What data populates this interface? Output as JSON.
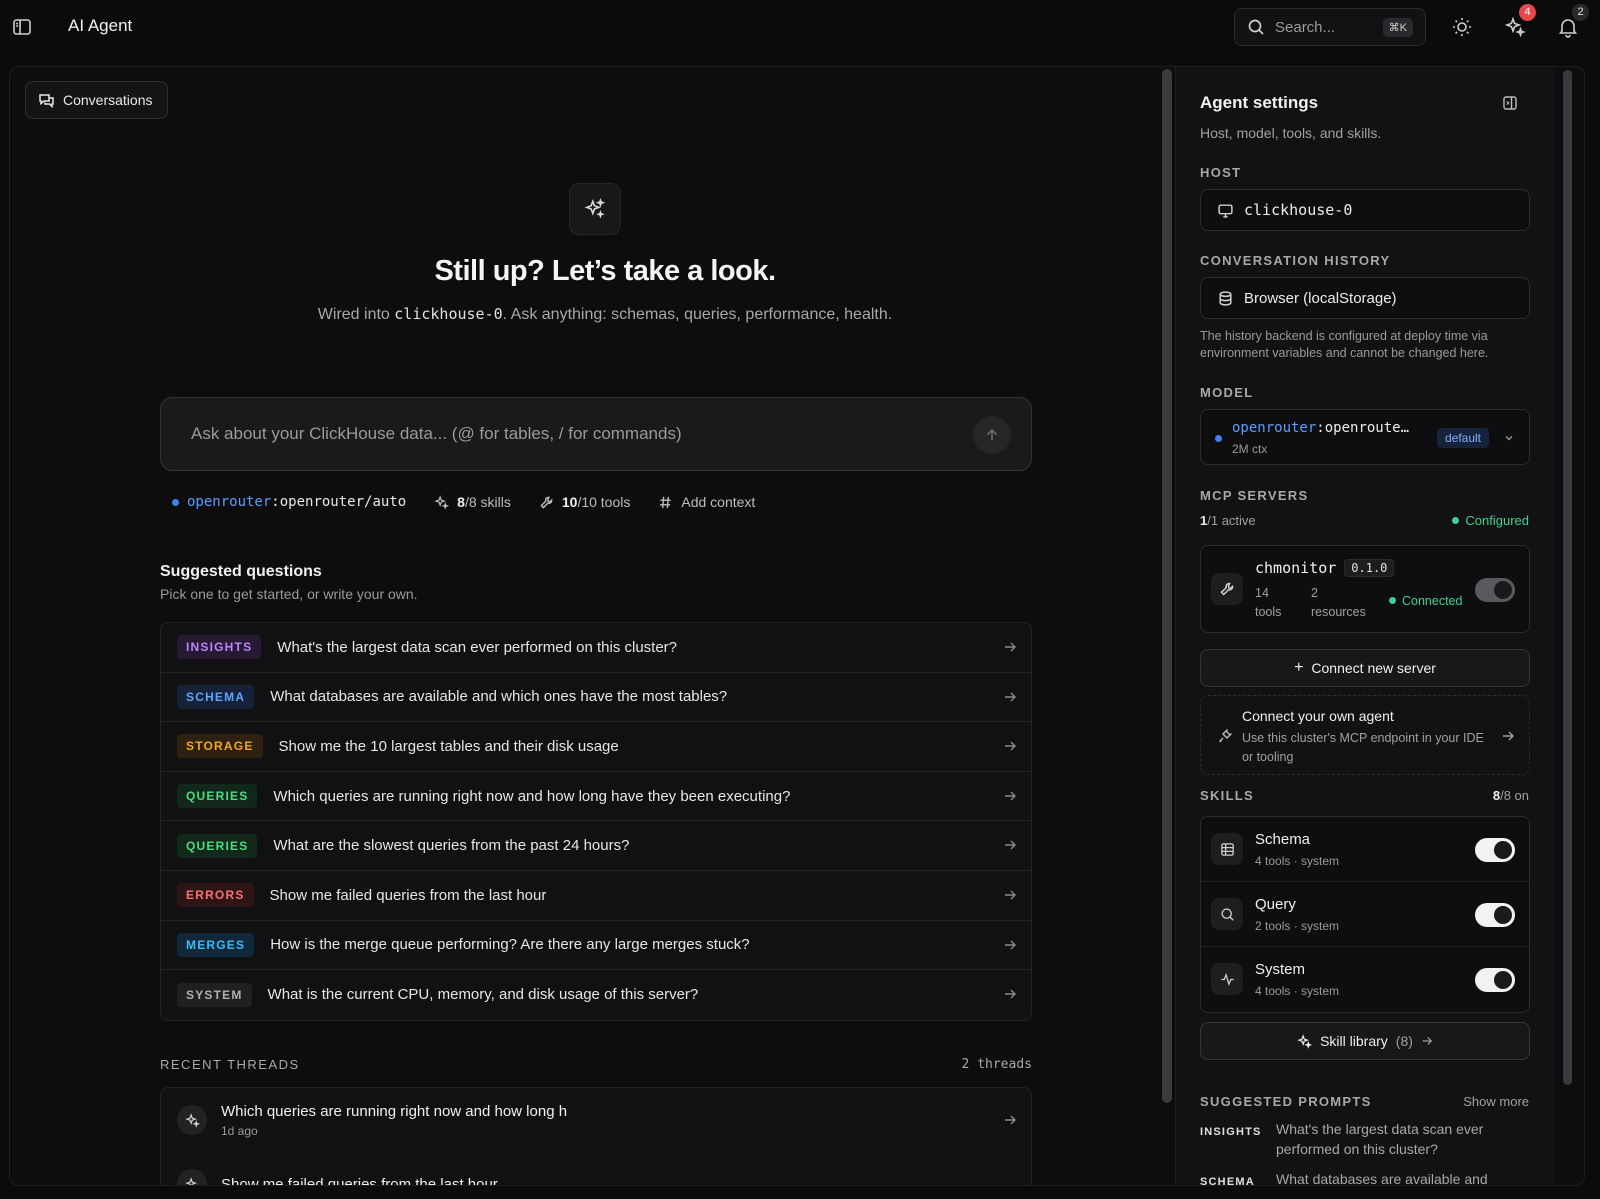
{
  "app": {
    "title": "AI Agent"
  },
  "top": {
    "search_placeholder": "Search...",
    "search_shortcut": "⌘K",
    "sparkle_badge": "4",
    "bell_badge": "2"
  },
  "conversations_button": "Conversations",
  "hero": {
    "title": "Still up? Let’s take a look.",
    "sub_pre": "Wired into ",
    "sub_host": "clickhouse-0",
    "sub_post": ". Ask anything: schemas, queries, performance, health."
  },
  "composer": {
    "placeholder": "Ask about your ClickHouse data... (@ for tables, / for commands)"
  },
  "meta": {
    "provider": "openrouter",
    "model": ":openrouter/auto",
    "skills_count": "8",
    "skills_rest": "/8 skills",
    "tools_count": "10",
    "tools_rest": "/10 tools",
    "add_context": "Add context"
  },
  "suggestions": {
    "title": "Suggested questions",
    "subtitle": "Pick one to get started, or write your own.",
    "items": [
      {
        "tag": "INSIGHTS",
        "text": "What's the largest data scan ever performed on this cluster?",
        "color": "#c084fc",
        "bg": "#261a33"
      },
      {
        "tag": "SCHEMA",
        "text": "What databases are available and which ones have the most tables?",
        "color": "#60a5fa",
        "bg": "#15223a"
      },
      {
        "tag": "STORAGE",
        "text": "Show me the 10 largest tables and their disk usage",
        "color": "#f5a524",
        "bg": "#2e2110"
      },
      {
        "tag": "QUERIES",
        "text": "Which queries are running right now and how long have they been executing?",
        "color": "#4ade80",
        "bg": "#12281a"
      },
      {
        "tag": "QUERIES",
        "text": "What are the slowest queries from the past 24 hours?",
        "color": "#4ade80",
        "bg": "#12281a"
      },
      {
        "tag": "ERRORS",
        "text": "Show me failed queries from the last hour",
        "color": "#f87171",
        "bg": "#2d1515"
      },
      {
        "tag": "MERGES",
        "text": "How is the merge queue performing? Are there any large merges stuck?",
        "color": "#38bdf8",
        "bg": "#10283a"
      },
      {
        "tag": "SYSTEM",
        "text": "What is the current CPU, memory, and disk usage of this server?",
        "color": "#b0b0b0",
        "bg": "#202023"
      }
    ]
  },
  "recent": {
    "label": "RECENT THREADS",
    "count": "2 threads",
    "threads": [
      {
        "title": "Which queries are running right now and how long h",
        "time": "1d ago"
      },
      {
        "title": "Show me failed queries from the last hour",
        "time": ""
      }
    ]
  },
  "panel": {
    "title": "Agent settings",
    "subtitle": "Host, model, tools, and skills.",
    "host_label": "HOST",
    "host_value": "clickhouse-0",
    "history_label": "CONVERSATION HISTORY",
    "history_value": "Browser (localStorage)",
    "history_note": "The history backend is configured at deploy time via environment variables and cannot be changed here.",
    "model_label": "MODEL",
    "model_provider": "openrouter",
    "model_name": ":openroute…",
    "model_ctx": "2M ctx",
    "model_badge": "default",
    "mcp_label": "MCP SERVERS",
    "mcp_active_count": "1",
    "mcp_active_rest": "/1 active",
    "mcp_status": "Configured",
    "server": {
      "name": "chmonitor",
      "version": "0.1.0",
      "tools_n": "14",
      "tools_l": "tools",
      "res_n": "2",
      "res_l": "resources",
      "status": "Connected",
      "enabled": false
    },
    "connect_btn": "Connect new server",
    "own_agent_title": "Connect your own agent",
    "own_agent_desc": "Use this cluster's MCP endpoint in your IDE or tooling",
    "skills_label": "SKILLS",
    "skills_on_count": "8",
    "skills_on_rest": "/8 on",
    "skills": [
      {
        "name": "Schema",
        "meta": "4 tools · system",
        "icon": "table-icon",
        "enabled": true
      },
      {
        "name": "Query",
        "meta": "2 tools · system",
        "icon": "search-icon",
        "enabled": true
      },
      {
        "name": "System",
        "meta": "4 tools · system",
        "icon": "activity-icon",
        "enabled": true
      }
    ],
    "skill_library": "Skill library",
    "skill_library_count": "(8)",
    "prompts_label": "SUGGESTED PROMPTS",
    "prompts_more": "Show more",
    "prompts": [
      {
        "tag": "INSIGHTS",
        "text": "What's the largest data scan ever performed on this cluster?"
      },
      {
        "tag": "SCHEMA",
        "text": "What databases are available and"
      }
    ]
  }
}
